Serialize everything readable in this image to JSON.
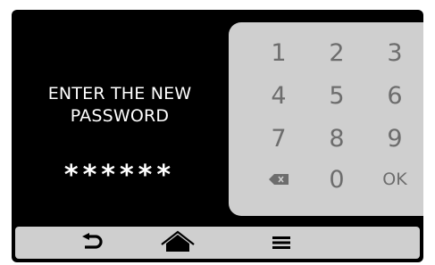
{
  "prompt": {
    "line1": "ENTER THE NEW",
    "line2": "PASSWORD"
  },
  "password_mask": "******",
  "keypad": {
    "k1": "1",
    "k2": "2",
    "k3": "3",
    "k4": "4",
    "k5": "5",
    "k6": "6",
    "k7": "7",
    "k8": "8",
    "k9": "9",
    "k0": "0",
    "ok": "OK",
    "backspace_icon": "backspace-icon"
  },
  "nav": {
    "back_icon": "back-arrow-icon",
    "home_icon": "home-icon",
    "menu_icon": "menu-icon"
  },
  "colors": {
    "background": "#000000",
    "panel": "#cfcfcf",
    "key_text": "#6d6d6d",
    "text": "#ffffff"
  }
}
